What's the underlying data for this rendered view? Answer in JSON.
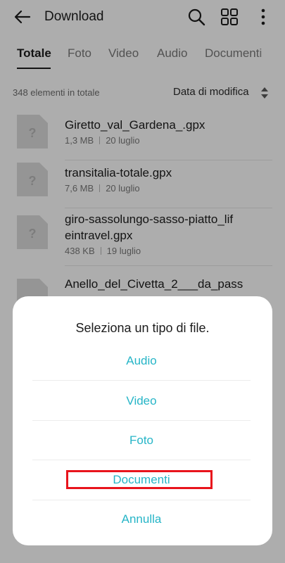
{
  "header": {
    "title": "Download",
    "back_icon": "arrow-left-icon",
    "search_icon": "search-icon",
    "grid_icon": "grid-view-icon",
    "more_icon": "more-vertical-icon"
  },
  "tabs": [
    {
      "label": "Totale",
      "active": true
    },
    {
      "label": "Foto",
      "active": false
    },
    {
      "label": "Video",
      "active": false
    },
    {
      "label": "Audio",
      "active": false
    },
    {
      "label": "Documenti",
      "active": false
    }
  ],
  "summary": {
    "count_text": "348 elementi in totale",
    "sort_label": "Data di modifica"
  },
  "files": [
    {
      "name": "Giretto_val_Gardena_.gpx",
      "size": "1,3 MB",
      "date": "20 luglio"
    },
    {
      "name": "transitalia-totale.gpx",
      "size": "7,6 MB",
      "date": "20 luglio"
    },
    {
      "name": "giro-sassolungo-sasso-piatto_lifeintravel.gpx",
      "name_line1": "giro-sassolungo-sasso-piatto_lif",
      "name_line2": "eintravel.gpx",
      "size": "438 KB",
      "date": "19 luglio"
    },
    {
      "name": "Anello_del_Civetta_2___da_pass",
      "size": "",
      "date": ""
    }
  ],
  "dialog": {
    "title": "Seleziona un tipo di file.",
    "options": [
      "Audio",
      "Video",
      "Foto",
      "Documenti"
    ],
    "cancel": "Annulla"
  },
  "colors": {
    "accent": "#26b5c7",
    "highlight": "#e8141c"
  }
}
